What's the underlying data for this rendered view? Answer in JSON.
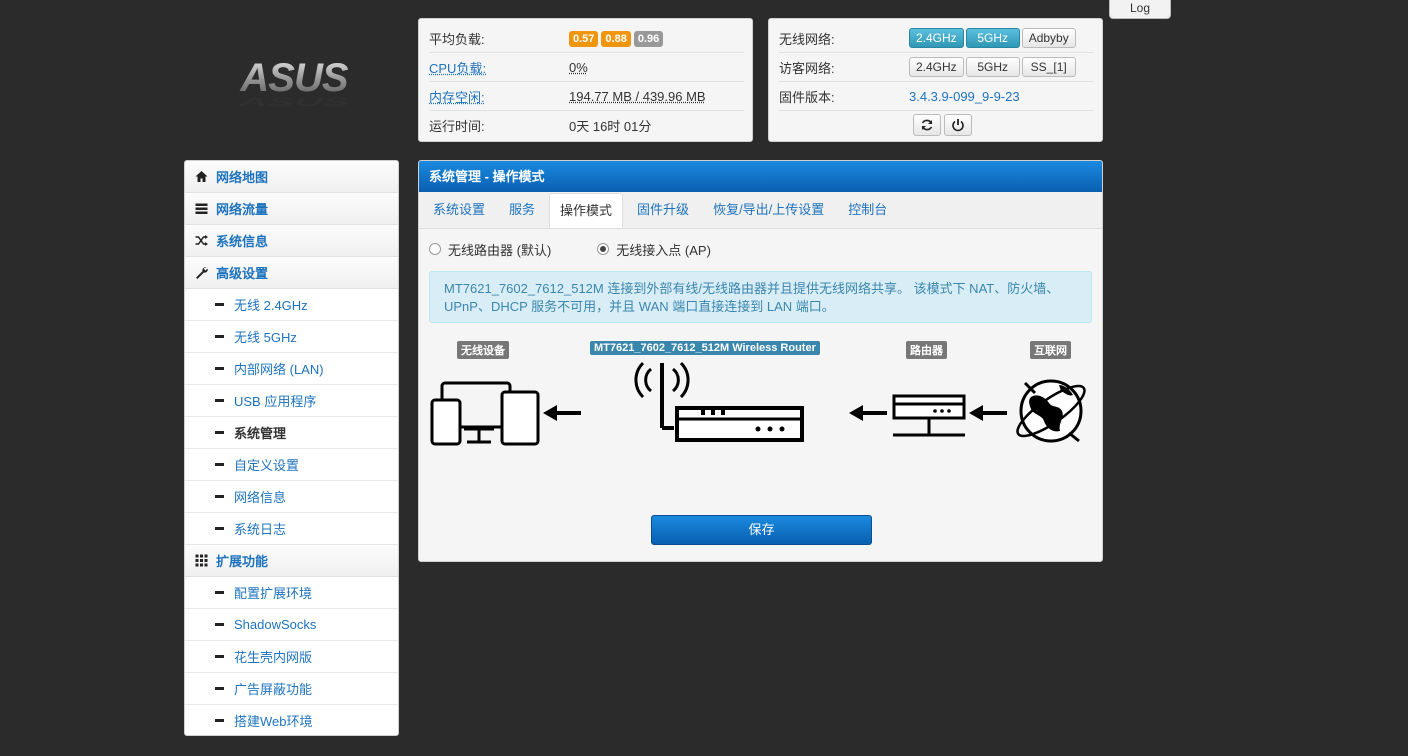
{
  "log_button": "Log",
  "logo_text": "ASUS",
  "system_status": {
    "load_label": "平均负载:",
    "load_values": [
      "0.57",
      "0.88",
      "0.96"
    ],
    "cpu_label": "CPU负载:",
    "cpu_value": "0%",
    "mem_label": "内存空闲:",
    "mem_value": "194.77 MB / 439.96 MB",
    "uptime_label": "运行时间:",
    "uptime_value": "0天 16时 01分"
  },
  "network_status": {
    "wireless_label": "无线网络:",
    "wireless_buttons": [
      "2.4GHz",
      "5GHz",
      "Adbyby"
    ],
    "guest_label": "访客网络:",
    "guest_buttons": [
      "2.4GHz",
      "5GHz",
      "SS_[1]"
    ],
    "firmware_label": "固件版本:",
    "firmware_value": "3.4.3.9-099_9-9-23"
  },
  "sidebar": {
    "items": [
      {
        "label": "网络地图",
        "icon": "home-icon"
      },
      {
        "label": "网络流量",
        "icon": "traffic-icon"
      },
      {
        "label": "系统信息",
        "icon": "shuffle-icon"
      },
      {
        "label": "高级设置",
        "icon": "wrench-icon"
      }
    ],
    "advanced_sub": [
      "无线 2.4GHz",
      "无线 5GHz",
      "内部网络 (LAN)",
      "USB 应用程序",
      "系统管理",
      "自定义设置",
      "网络信息",
      "系统日志"
    ],
    "ext_label": "扩展功能",
    "ext_sub": [
      "配置扩展环境",
      "ShadowSocks",
      "花生壳内网版",
      "广告屏蔽功能",
      "搭建Web环境"
    ]
  },
  "main": {
    "header": "系统管理 - 操作模式",
    "tabs": [
      "系统设置",
      "服务",
      "操作模式",
      "固件升级",
      "恢复/导出/上传设置",
      "控制台"
    ],
    "radio_router": "无线路由器 (默认)",
    "radio_ap": "无线接入点 (AP)",
    "info": "MT7621_7602_7612_512M 连接到外部有线/无线路由器并且提供无线网络共享。 该模式下 NAT、防火墙、UPnP、DHCP 服务不可用，并且 WAN 端口直接连接到 LAN 端口。",
    "diagram_labels": {
      "devices": "无线设备",
      "router": "MT7621_7602_7612_512M Wireless Router",
      "upstream": "路由器",
      "internet": "互联网"
    },
    "save": "保存"
  }
}
